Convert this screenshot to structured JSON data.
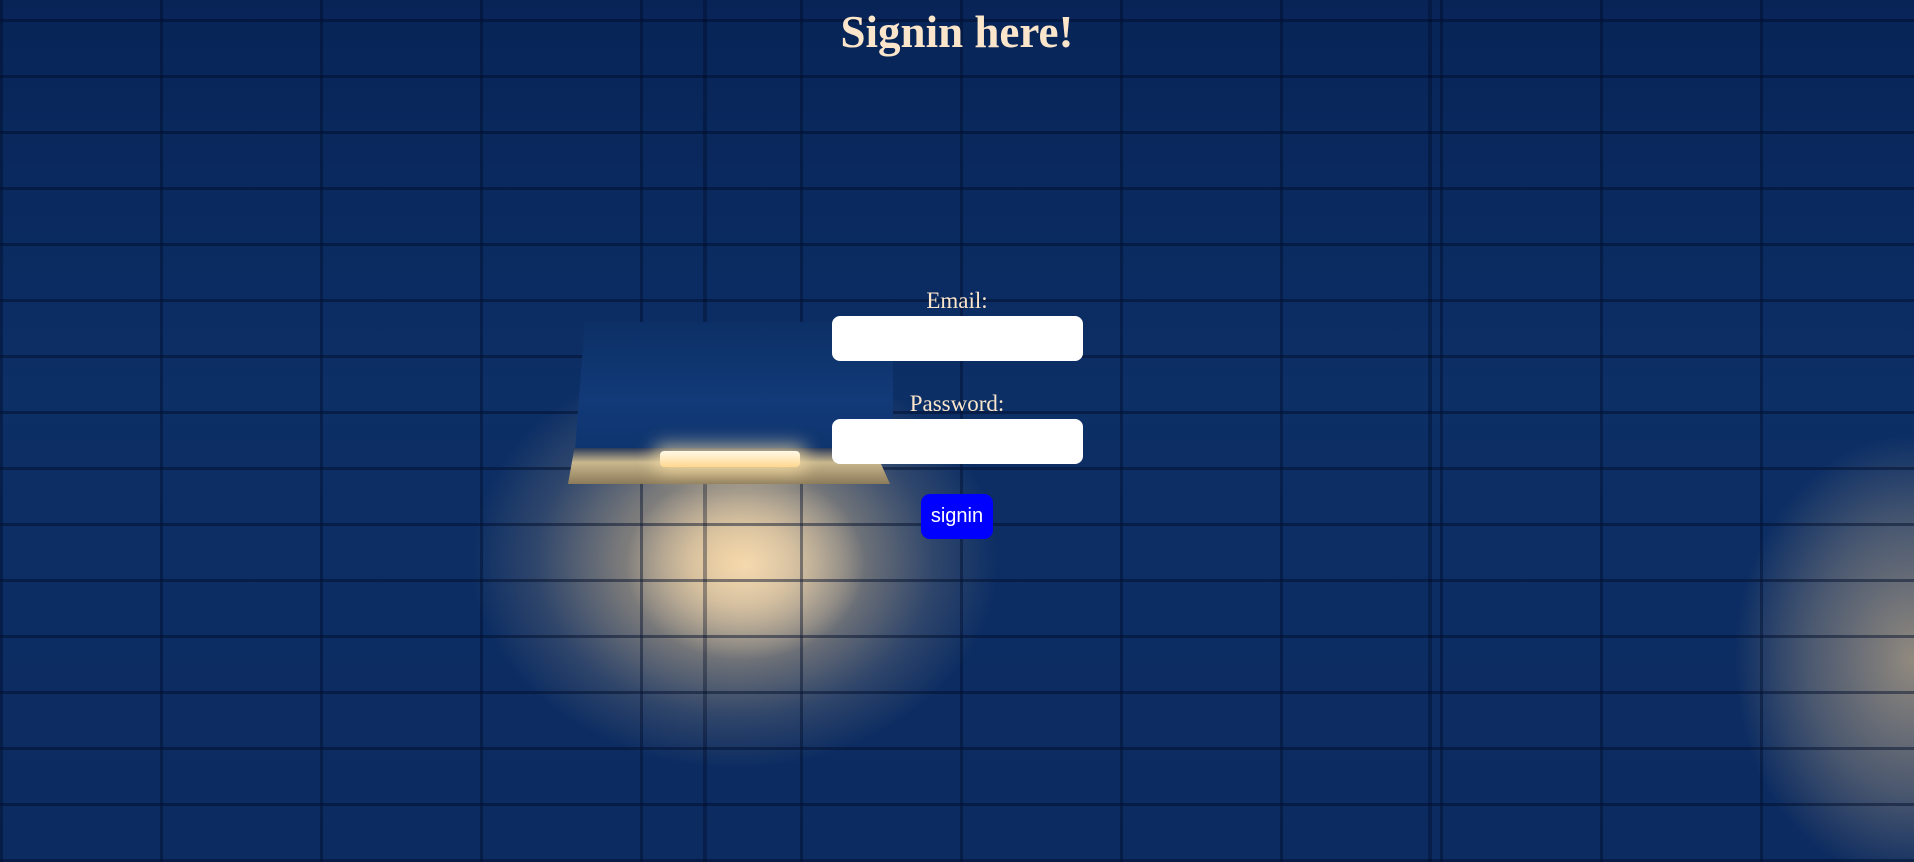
{
  "page": {
    "title": "Signin here!"
  },
  "form": {
    "email_label": "Email:",
    "email_value": "",
    "password_label": "Password:",
    "password_value": "",
    "submit_label": "signin"
  },
  "colors": {
    "heading_text": "#fbe6cb",
    "label_text": "#fbe6cb",
    "button_background": "#0000ff",
    "button_text": "#ffffff",
    "input_background": "#ffffff"
  },
  "background": {
    "description_icon": "brick-wall-with-lamp-image"
  }
}
